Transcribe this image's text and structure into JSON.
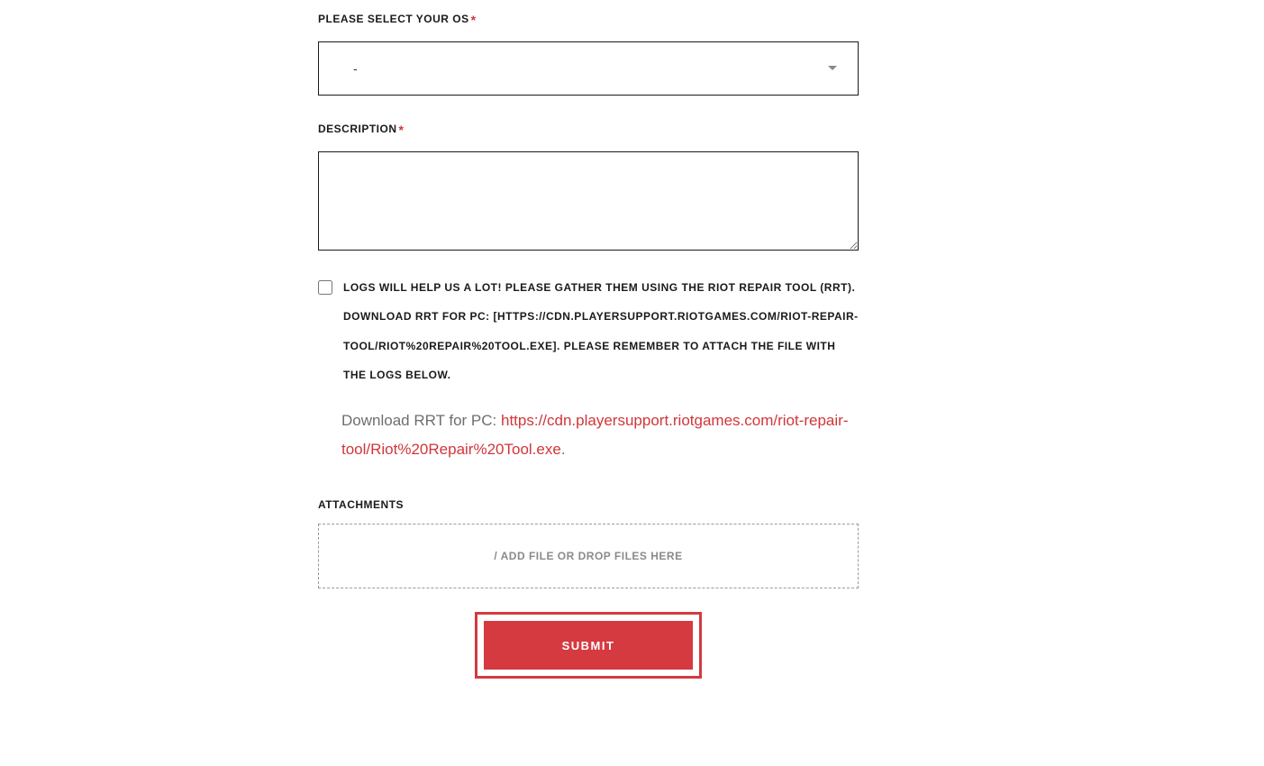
{
  "form": {
    "os": {
      "label": "PLEASE SELECT YOUR OS",
      "value": "-"
    },
    "description": {
      "label": "DESCRIPTION",
      "value": ""
    },
    "logs": {
      "checkbox_label": "LOGS WILL HELP US A LOT! PLEASE GATHER THEM USING THE RIOT REPAIR TOOL (RRT). DOWNLOAD RRT FOR PC: [HTTPS://CDN.PLAYERSUPPORT.RIOTGAMES.COM/RIOT-REPAIR-TOOL/RIOT%20REPAIR%20TOOL.EXE]. PLEASE REMEMBER TO ATTACH THE FILE WITH THE LOGS BELOW.",
      "helper_prefix": "Download RRT for PC: ",
      "helper_link": "https://cdn.playersupport.riotgames.com/riot-repair-tool/Riot%20Repair%20Tool.exe",
      "helper_suffix": "."
    },
    "attachments": {
      "label": "ATTACHMENTS",
      "dropzone_text": "/ ADD FILE OR DROP FILES HERE"
    },
    "submit": {
      "label": "SUBMIT"
    }
  }
}
